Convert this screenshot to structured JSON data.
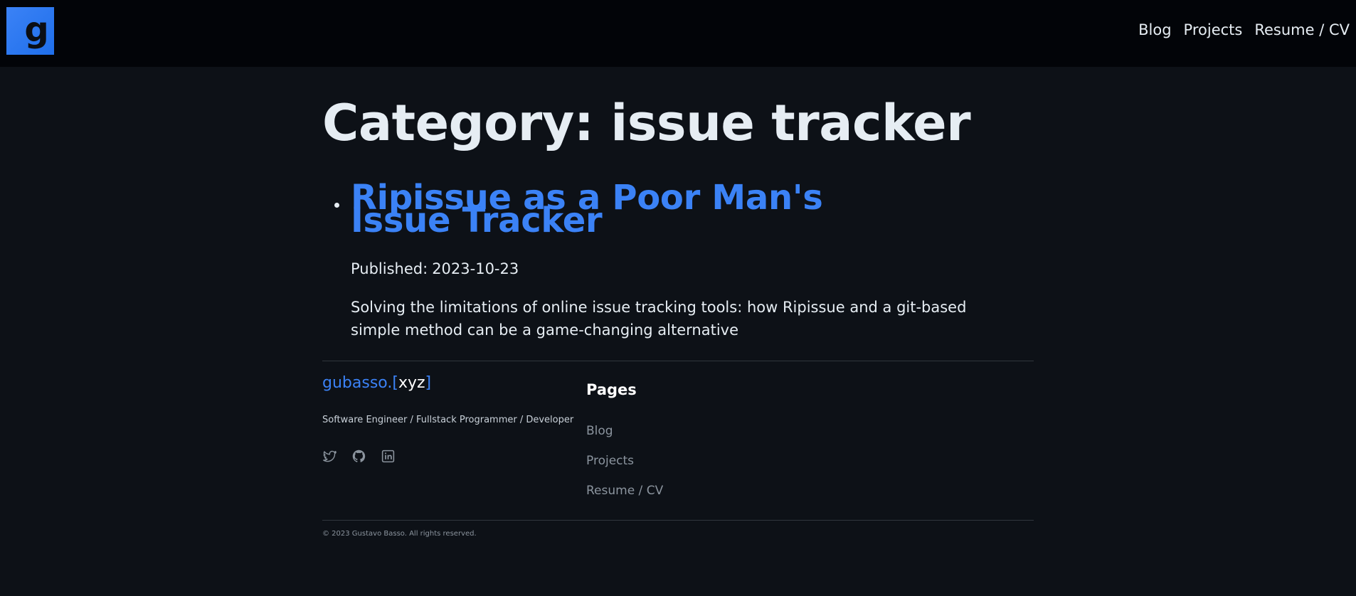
{
  "header": {
    "logo_letter": "g",
    "nav": [
      {
        "label": "Blog"
      },
      {
        "label": "Projects"
      },
      {
        "label": "Resume / CV"
      }
    ]
  },
  "main": {
    "title": "Category: issue tracker",
    "posts": [
      {
        "title": "Ripissue as a Poor Man's Issue Tracker",
        "published_label": "Published:",
        "published_date": "2023-10-23",
        "excerpt": "Solving the limitations of online issue tracking tools: how Ripissue and a git-based simple method can be a game-changing alternative"
      }
    ]
  },
  "footer": {
    "brand_main": "gubasso.",
    "brand_open": "[",
    "brand_xyz": "xyz",
    "brand_close": "]",
    "tagline": "Software Engineer / Fullstack Programmer / Developer",
    "socials": [
      {
        "icon": "twitter-icon"
      },
      {
        "icon": "github-icon"
      },
      {
        "icon": "linkedin-icon"
      }
    ],
    "pages_heading": "Pages",
    "pages": [
      {
        "label": "Blog"
      },
      {
        "label": "Projects"
      },
      {
        "label": "Resume / CV"
      }
    ],
    "copyright": "© 2023 Gustavo Basso. All rights reserved."
  },
  "colors": {
    "background": "#0d1117",
    "header_background": "#020408",
    "accent": "#3b82f6",
    "text": "#e6edf3",
    "muted": "#8b949e"
  }
}
